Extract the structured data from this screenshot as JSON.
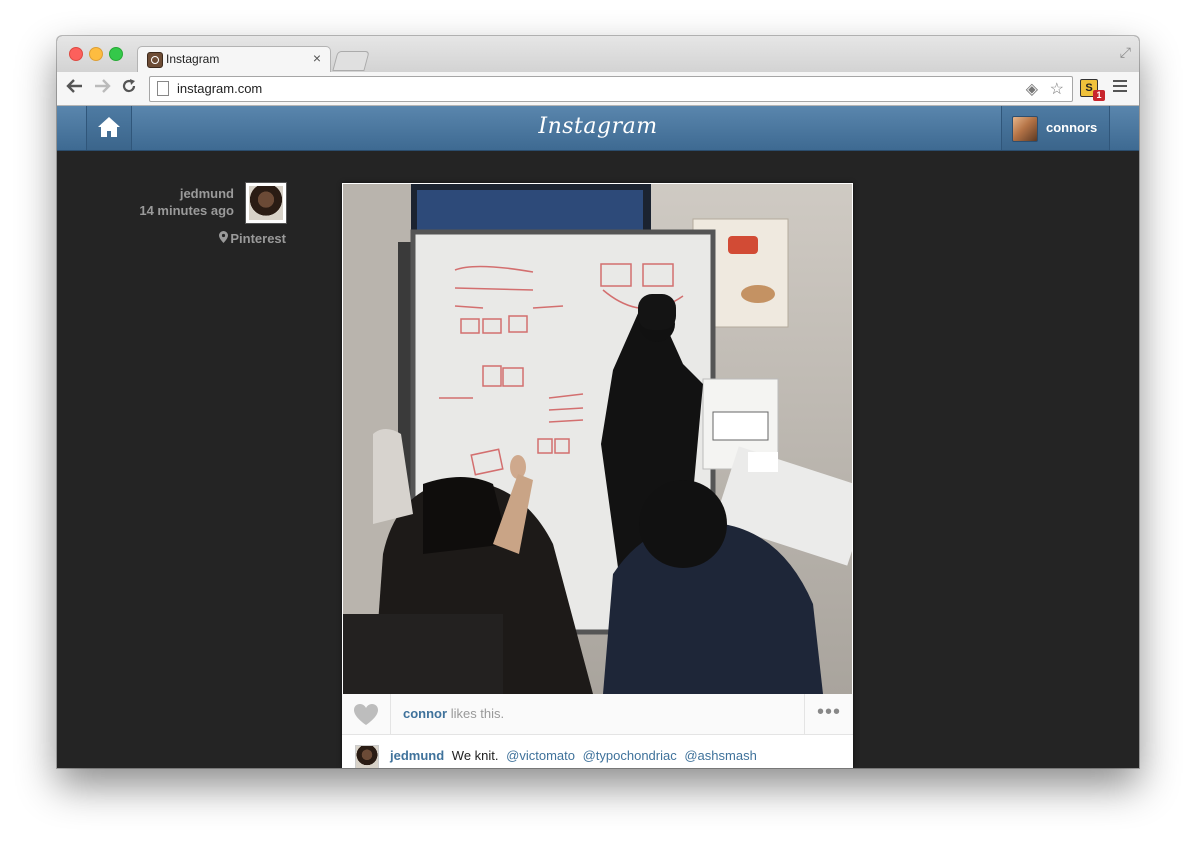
{
  "browser": {
    "tab_title": "Instagram",
    "tab_close": "×",
    "url": "instagram.com",
    "extension_badge": "1",
    "extension_letter": "S"
  },
  "header": {
    "logo": "Instagram",
    "username": "connors"
  },
  "post": {
    "author": "jedmund",
    "time_ago": "14 minutes ago",
    "location": "Pinterest",
    "likes_user": "connor",
    "likes_suffix": "likes this.",
    "more_label": "•••",
    "caption_user": "jedmund",
    "caption_text": "We knit.",
    "mentions": [
      "@victomato",
      "@typochondriac",
      "@ashsmash"
    ]
  },
  "icons": {
    "back": "back-arrow-icon",
    "forward": "forward-arrow-icon",
    "reload": "reload-icon",
    "home": "home-icon",
    "heart": "heart-icon",
    "pin": "location-pin-icon"
  },
  "colors": {
    "header_blue": "#517fa4",
    "link_blue": "#3f729b",
    "page_bg": "#242424"
  }
}
